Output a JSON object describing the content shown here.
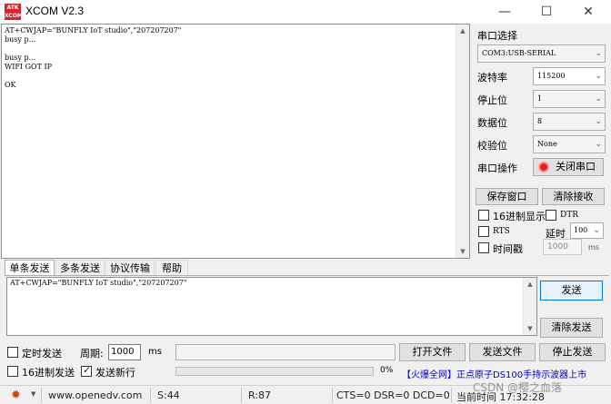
{
  "window": {
    "title": "XCOM V2.3",
    "logo_text": "ATK XCOM"
  },
  "receive": {
    "lines": "AT+CWJAP=\"BUNFLY IoT studio\",\"207207207\"\nbusy p...\n\nbusy p...\nWIFI GOT IP\n\nOK"
  },
  "right": {
    "port_label": "串口选择",
    "port_value": "COM3:USB-SERIAL",
    "baud_label": "波特率",
    "baud_value": "115200",
    "stop_label": "停止位",
    "stop_value": "1",
    "data_label": "数据位",
    "data_value": "8",
    "parity_label": "校验位",
    "parity_value": "None",
    "op_label": "串口操作",
    "close_port": "关闭串口",
    "save_window": "保存窗口",
    "clear_recv": "清除接收",
    "hex_display": "16进制显示",
    "dtr": "DTR",
    "rts": "RTS",
    "delay_label": "延时",
    "delay_value": "100",
    "timestamp": "时间戳",
    "timestamp_value": "1000",
    "ms": "ms"
  },
  "tabs": [
    "单条发送",
    "多条发送",
    "协议传输",
    "帮助"
  ],
  "send": {
    "text": "AT+CWJAP=\"BUNFLY IoT studio\",\"207207207\"",
    "send_btn": "发送",
    "clear_send": "清除发送",
    "timed_send": "定时发送",
    "period_label": "周期:",
    "period_value": "1000",
    "ms": "ms",
    "open_file": "打开文件",
    "send_file": "发送文件",
    "stop_send": "停止发送",
    "hex_send": "16进制发送",
    "newline": "发送新行",
    "progress_text": "0%",
    "progress": 0,
    "promo": "【火爆全网】正点原子DS100手持示波器上市"
  },
  "status": {
    "url": "www.openedv.com",
    "s": "S:44",
    "r": "R:87",
    "lines": "CTS=0 DSR=0 DCD=0",
    "time": "当前时间 17:32:28",
    "watermark": "CSDN @樱之血落"
  },
  "colors": {
    "accent_blue": "#0000cc",
    "promo_red": "#cc0000",
    "close_icon_red": "#e02020"
  }
}
